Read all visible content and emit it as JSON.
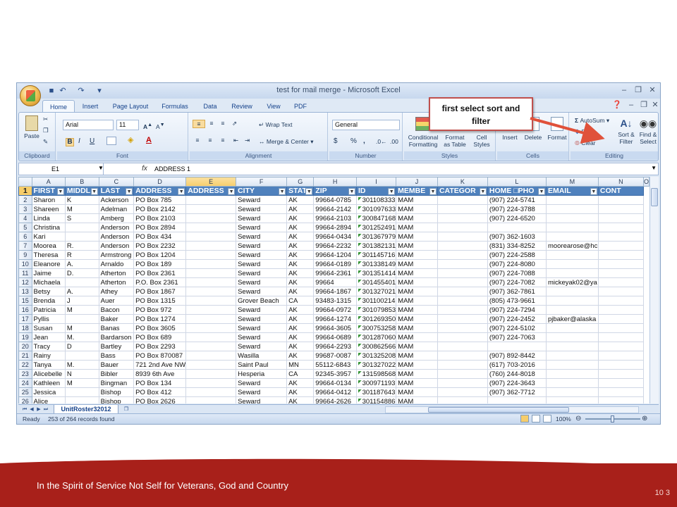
{
  "window": {
    "title": "test for mail merge - Microsoft Excel"
  },
  "ribbon": {
    "tabs": [
      "Home",
      "Insert",
      "Page Layout",
      "Formulas",
      "Data",
      "Review",
      "View",
      "PDF"
    ],
    "groups": [
      "Clipboard",
      "Font",
      "Alignment",
      "Number",
      "Styles",
      "Cells",
      "Editing"
    ],
    "clipboard": {
      "paste": "Paste"
    },
    "font": {
      "name": "Arial",
      "size": "11"
    },
    "alignment": {
      "wrap_text": "Wrap Text",
      "merge_center": "Merge & Center"
    },
    "number": {
      "format": "General",
      "currency": "$",
      "percent": "%",
      "comma": ","
    },
    "styles": {
      "conditional": "Conditional Formatting",
      "format_table": "Format as Table",
      "cell_styles": "Cell Styles"
    },
    "cells": {
      "insert": "Insert",
      "delete": "Delete",
      "format": "Format"
    },
    "editing": {
      "autosum": "AutoSum",
      "fill": "Fill",
      "clear": "Clear",
      "sort_filter": "Sort & Filter",
      "find_select": "Find & Select"
    }
  },
  "callout": {
    "line1": "first select sort and",
    "line2": "filter"
  },
  "formula_bar": {
    "name_box": "E1",
    "fx": "fx",
    "content": "ADDRESS 1"
  },
  "grid": {
    "columns": [
      "A",
      "B",
      "C",
      "D",
      "E",
      "F",
      "G",
      "H",
      "I",
      "J",
      "K",
      "L",
      "M",
      "N",
      "O"
    ],
    "headers": [
      "FIRST",
      "MIDDL",
      "LAST",
      "ADDRESS",
      "ADDRESS",
      "CITY",
      "STAT",
      "ZIP",
      "ID",
      "MEMBE",
      "CATEGOR",
      "HOME □PHO",
      "EMAIL",
      "CONT"
    ],
    "rows": [
      {
        "num": "2",
        "cells": [
          "Sharon",
          "K",
          "Ackerson",
          "PO Box 785",
          "",
          "Seward",
          "AK",
          "99664-0785",
          "301108333",
          "MAM",
          "",
          "(907) 224-5741",
          "",
          ""
        ]
      },
      {
        "num": "3",
        "cells": [
          "Shareen",
          "M",
          "Adelman",
          "PO Box 2142",
          "",
          "Seward",
          "AK",
          "99664-2142",
          "301097633",
          "MAM",
          "",
          "(907) 224-3788",
          "",
          ""
        ]
      },
      {
        "num": "4",
        "cells": [
          "Linda",
          "S",
          "Amberg",
          "PO Box 2103",
          "",
          "Seward",
          "AK",
          "99664-2103",
          "300847168",
          "MAM",
          "",
          "(907) 224-6520",
          "",
          ""
        ]
      },
      {
        "num": "5",
        "cells": [
          "Christina",
          "",
          "Anderson",
          "PO Box 2894",
          "",
          "Seward",
          "AK",
          "99664-2894",
          "301252491",
          "MAM",
          "",
          "",
          "",
          ""
        ]
      },
      {
        "num": "6",
        "cells": [
          "Kari",
          "",
          "Anderson",
          "PO Box 434",
          "",
          "Seward",
          "AK",
          "99664-0434",
          "301367979",
          "MAM",
          "",
          "(907) 362-1603",
          "",
          ""
        ]
      },
      {
        "num": "7",
        "cells": [
          "Moorea",
          "R.",
          "Anderson",
          "PO Box 2232",
          "",
          "Seward",
          "AK",
          "99664-2232",
          "301382131",
          "MAM",
          "",
          "(831) 334-8252",
          "moorearose@hc",
          ""
        ]
      },
      {
        "num": "9",
        "cells": [
          "Theresa",
          "R",
          "Armstrong",
          "PO Box 1204",
          "",
          "Seward",
          "AK",
          "99664-1204",
          "301145716",
          "MAM",
          "",
          "(907) 224-2588",
          "",
          ""
        ]
      },
      {
        "num": "10",
        "cells": [
          "Eleanore",
          "A.",
          "Arnaldo",
          "PO Box 189",
          "",
          "Seward",
          "AK",
          "99664-0189",
          "301338149",
          "MAM",
          "",
          "(907) 224-8080",
          "",
          ""
        ]
      },
      {
        "num": "11",
        "cells": [
          "Jaime",
          "D.",
          "Atherton",
          "PO Box 2361",
          "",
          "Seward",
          "AK",
          "99664-2361",
          "301351414",
          "MAM",
          "",
          "(907) 224-7088",
          "",
          ""
        ]
      },
      {
        "num": "12",
        "cells": [
          "Michaela",
          "",
          "Atherton",
          "P.O. Box 2361",
          "",
          "Seward",
          "AK",
          "99664",
          "301455401",
          "MAM",
          "",
          "(907) 224-7082",
          "mickeyak02@ya",
          ""
        ]
      },
      {
        "num": "13",
        "cells": [
          "Betsy",
          "A.",
          "Athey",
          "PO Box 1867",
          "",
          "Seward",
          "AK",
          "99664-1867",
          "301327021",
          "MAM",
          "",
          "(907) 362-7861",
          "",
          ""
        ]
      },
      {
        "num": "15",
        "cells": [
          "Brenda",
          "J",
          "Auer",
          "PO Box 1315",
          "",
          "Grover Beach",
          "CA",
          "93483-1315",
          "301100214",
          "MAM",
          "",
          "(805) 473-9661",
          "",
          ""
        ]
      },
      {
        "num": "16",
        "cells": [
          "Patricia",
          "M",
          "Bacon",
          "PO Box 972",
          "",
          "Seward",
          "AK",
          "99664-0972",
          "301079853",
          "MAM",
          "",
          "(907) 224-7294",
          "",
          ""
        ]
      },
      {
        "num": "17",
        "cells": [
          "Pyllis",
          "",
          "Baker",
          "PO Box 1274",
          "",
          "Seward",
          "AK",
          "99664-1274",
          "301269350",
          "MAM",
          "",
          "(907) 224-2452",
          "pjbaker@alaska",
          ""
        ]
      },
      {
        "num": "18",
        "cells": [
          "Susan",
          "M",
          "Banas",
          "PO Box 3605",
          "",
          "Seward",
          "AK",
          "99664-3605",
          "300753258",
          "MAM",
          "",
          "(907) 224-5102",
          "",
          ""
        ]
      },
      {
        "num": "19",
        "cells": [
          "Jean",
          "M.",
          "Bardarson",
          "PO Box 689",
          "",
          "Seward",
          "AK",
          "99664-0689",
          "301287060",
          "MAM",
          "",
          "(907) 224-7063",
          "",
          ""
        ]
      },
      {
        "num": "20",
        "cells": [
          "Tracy",
          "D",
          "Bartley",
          "PO Box 2293",
          "",
          "Seward",
          "AK",
          "99664-2293",
          "300862566",
          "MAM",
          "",
          "",
          "",
          ""
        ]
      },
      {
        "num": "21",
        "cells": [
          "Rainy",
          "",
          "Bass",
          "PO Box 870087",
          "",
          "Wasilla",
          "AK",
          "99687-0087",
          "301325208",
          "MAM",
          "",
          "(907) 892-8442",
          "",
          ""
        ]
      },
      {
        "num": "22",
        "cells": [
          "Tanya",
          "M.",
          "Bauer",
          "721 2nd Ave NW",
          "",
          "Saint Paul",
          "MN",
          "55112-6843",
          "301327022",
          "MAM",
          "",
          "(617) 703-2016",
          "",
          ""
        ]
      },
      {
        "num": "23",
        "cells": [
          "Alicebelle",
          "N",
          "Bibler",
          "8939 6th Ave",
          "",
          "Hesperia",
          "CA",
          "92345-3957",
          "131598568",
          "MAM",
          "",
          "(760) 244-8018",
          "",
          ""
        ]
      },
      {
        "num": "24",
        "cells": [
          "Kathleen",
          "M",
          "Bingman",
          "PO Box 134",
          "",
          "Seward",
          "AK",
          "99664-0134",
          "300971193",
          "MAM",
          "",
          "(907) 224-3643",
          "",
          ""
        ]
      },
      {
        "num": "25",
        "cells": [
          "Jessica",
          "",
          "Bishop",
          "PO Box 412",
          "",
          "Seward",
          "AK",
          "99664-0412",
          "301187643",
          "MAM",
          "",
          "(907) 362-7712",
          "",
          ""
        ]
      },
      {
        "num": "26",
        "cells": [
          "Alice",
          "",
          "Bishop",
          "PO Box 2626",
          "",
          "Seward",
          "AK",
          "99664-2626",
          "301154886",
          "MAM",
          "",
          "",
          "",
          ""
        ]
      }
    ]
  },
  "sheet": {
    "tab_name": "UnitRoster32012"
  },
  "status": {
    "ready": "Ready",
    "records": "253 of 264 records found",
    "zoom": "100%"
  },
  "footer": {
    "text": "In the Spirit of Service Not Self  for Veterans, God and Country",
    "page": "10 3"
  },
  "colors": {
    "header_fill": "#4f81bd",
    "footer_band": "#a8201a",
    "callout_border": "#c0504d",
    "arrow": "#e0513a"
  }
}
